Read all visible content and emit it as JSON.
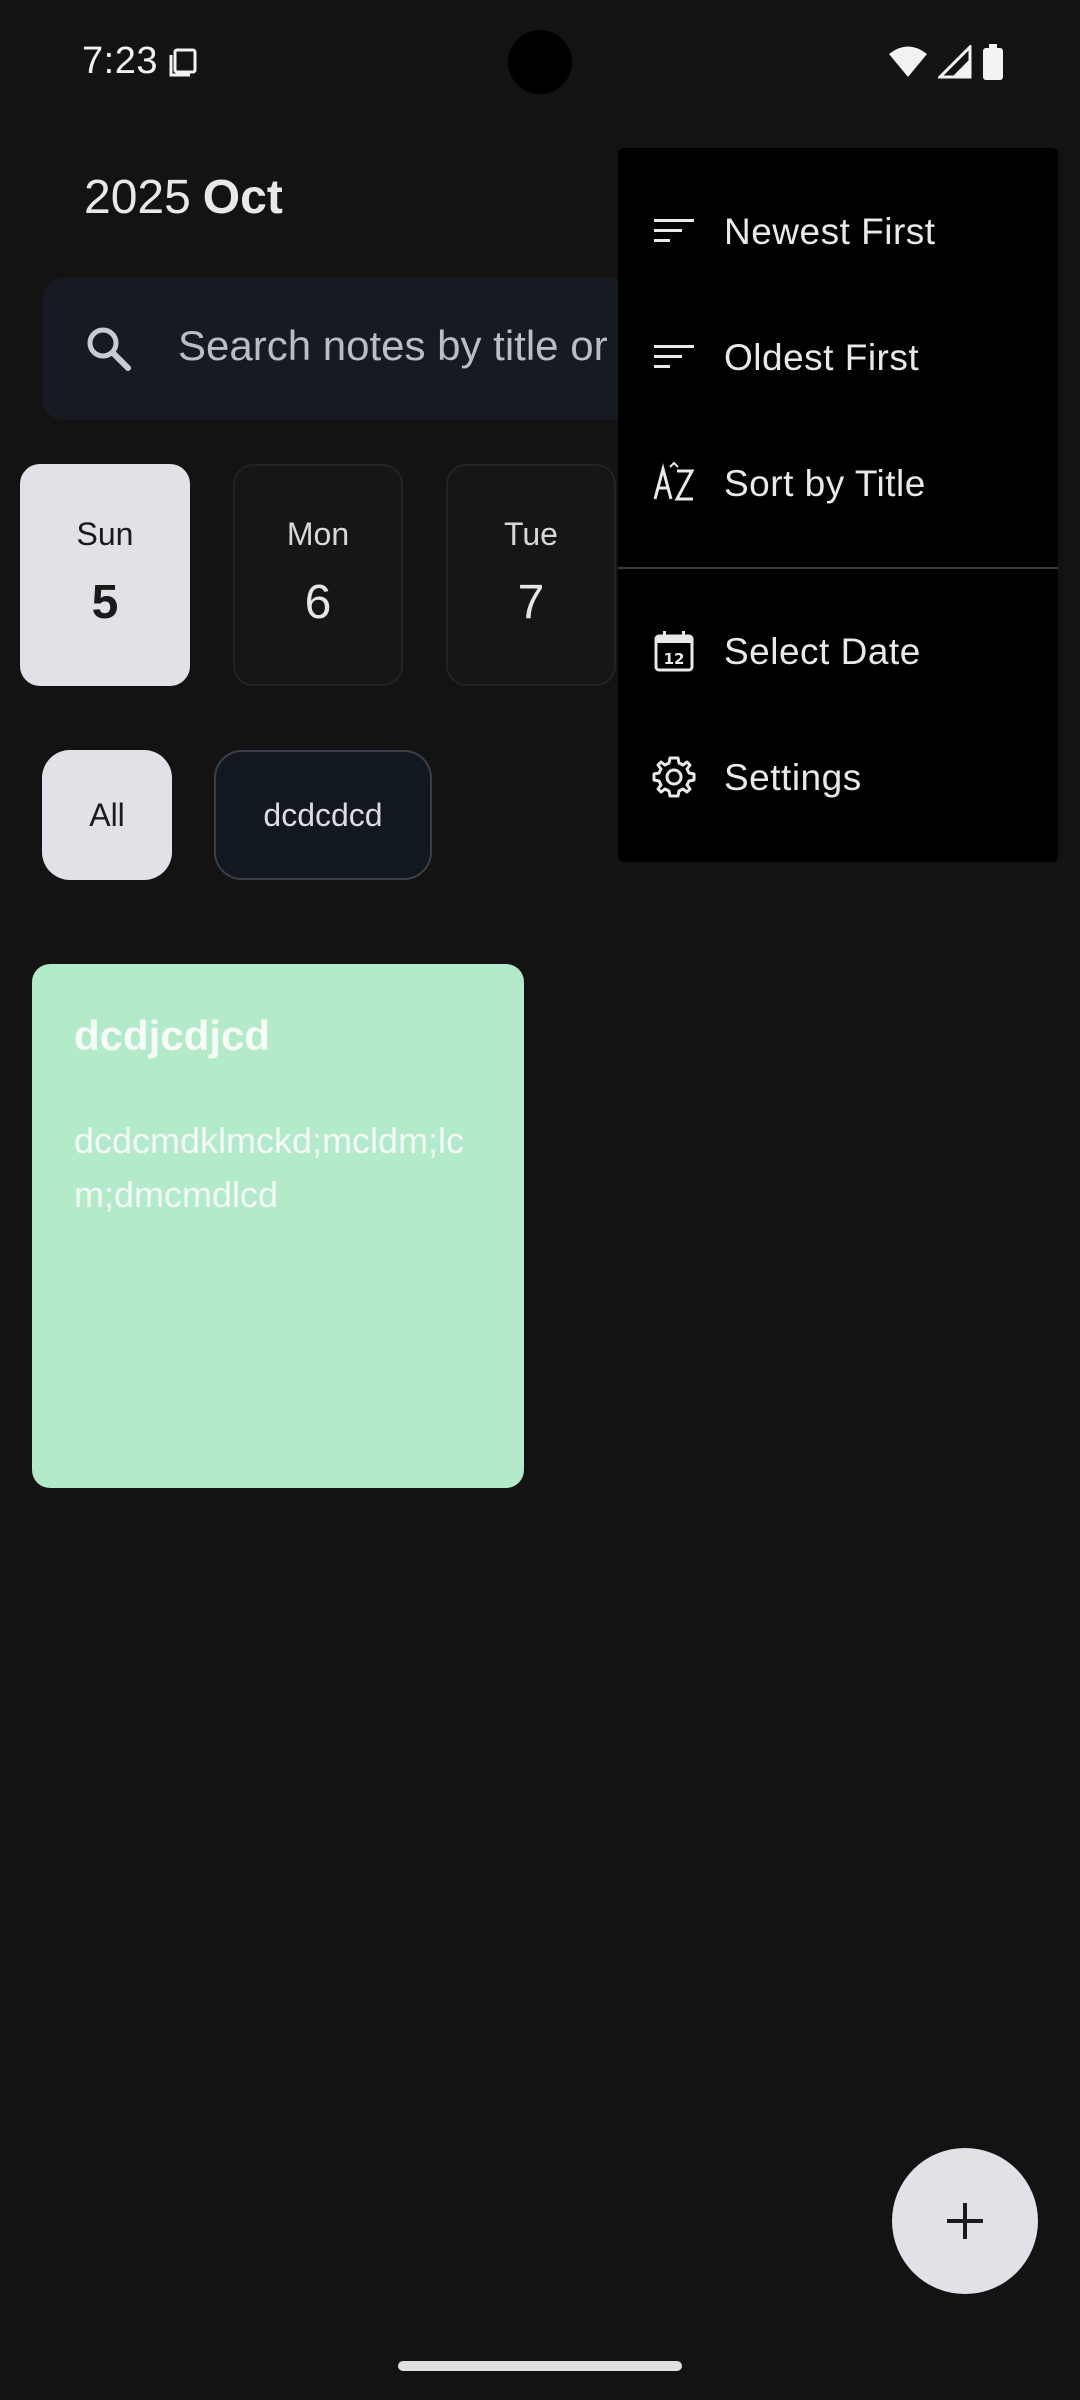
{
  "status_bar": {
    "time": "7:23",
    "icons": [
      "notification-icon",
      "wifi-icon",
      "cellular-icon",
      "battery-icon"
    ]
  },
  "header": {
    "year": "2025",
    "month": "Oct"
  },
  "search": {
    "placeholder": "Search notes by title or"
  },
  "days": [
    {
      "dow": "Sun",
      "num": "5",
      "selected": true
    },
    {
      "dow": "Mon",
      "num": "6",
      "selected": false
    },
    {
      "dow": "Tue",
      "num": "7",
      "selected": false
    }
  ],
  "filters": [
    {
      "label": "All",
      "selected": true
    },
    {
      "label": "dcdcdcd",
      "selected": false
    }
  ],
  "notes": [
    {
      "title": "dcdjcdjcd",
      "body": "dcdcmdklmckd;mcldm;lcm;dmcmdlcd",
      "color": "#b2eaca"
    }
  ],
  "menu": {
    "items": [
      {
        "label": "Newest First",
        "icon": "sort-icon"
      },
      {
        "label": "Oldest First",
        "icon": "sort-icon"
      },
      {
        "label": "Sort by Title",
        "icon": "sort-alpha-icon"
      },
      {
        "label": "Select Date",
        "icon": "calendar-icon"
      },
      {
        "label": "Settings",
        "icon": "gear-icon"
      }
    ]
  },
  "fab": {
    "icon": "plus-icon"
  },
  "colors": {
    "background": "#131313",
    "chip_selected": "#e1e2e8",
    "note_card": "#b2eaca",
    "menu_background": "#000000"
  }
}
